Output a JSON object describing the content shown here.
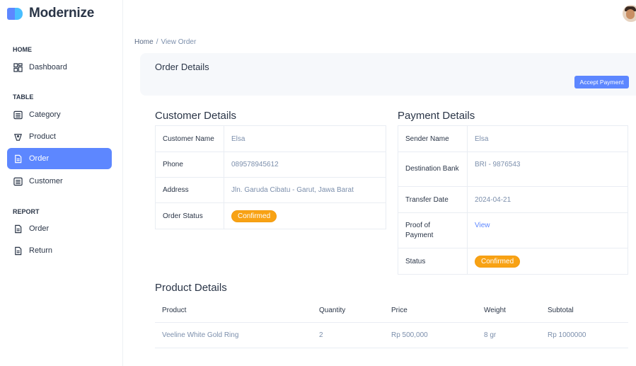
{
  "app": {
    "name": "Modernize"
  },
  "sidebar": {
    "sections": [
      {
        "title": "HOME"
      },
      {
        "title": "TABLE"
      },
      {
        "title": "REPORT"
      }
    ],
    "items": [
      {
        "label": "Dashboard",
        "icon": "dashboard-icon"
      },
      {
        "label": "Category",
        "icon": "list-icon"
      },
      {
        "label": "Product",
        "icon": "tag-icon"
      },
      {
        "label": "Order",
        "icon": "file-icon",
        "active": true
      },
      {
        "label": "Customer",
        "icon": "list-icon"
      },
      {
        "label": "Order",
        "icon": "file-icon"
      },
      {
        "label": "Return",
        "icon": "file-icon"
      }
    ]
  },
  "breadcrumb": {
    "home": "Home",
    "separator": "/",
    "current": "View Order"
  },
  "order": {
    "title": "Order Details",
    "accept_label": "Accept Payment"
  },
  "customer": {
    "title": "Customer Details",
    "rows": [
      {
        "label": "Customer Name",
        "value": "Elsa"
      },
      {
        "label": "Phone",
        "value": "089578945612"
      },
      {
        "label": "Address",
        "value": "Jln. Garuda Cibatu - Garut, Jawa Barat"
      },
      {
        "label": "Order Status",
        "value": "Confirmed"
      }
    ]
  },
  "payment": {
    "title": "Payment Details",
    "rows": [
      {
        "label": "Sender Name",
        "value": "Elsa"
      },
      {
        "label": "Destination Bank",
        "value": "BRI - 9876543"
      },
      {
        "label": "Transfer Date",
        "value": "2024-04-21"
      },
      {
        "label": "Proof of Payment",
        "value": "View"
      },
      {
        "label": "Status",
        "value": "Confirmed"
      }
    ]
  },
  "products": {
    "title": "Product Details",
    "headers": [
      "Product",
      "Quantity",
      "Price",
      "Weight",
      "Subtotal"
    ],
    "rows": [
      [
        "Veeline White Gold Ring",
        "2",
        "Rp 500,000",
        "8 gr",
        "Rp 1000000"
      ]
    ]
  },
  "colors": {
    "accent": "#5d87ff",
    "badge": "#f8a214"
  }
}
